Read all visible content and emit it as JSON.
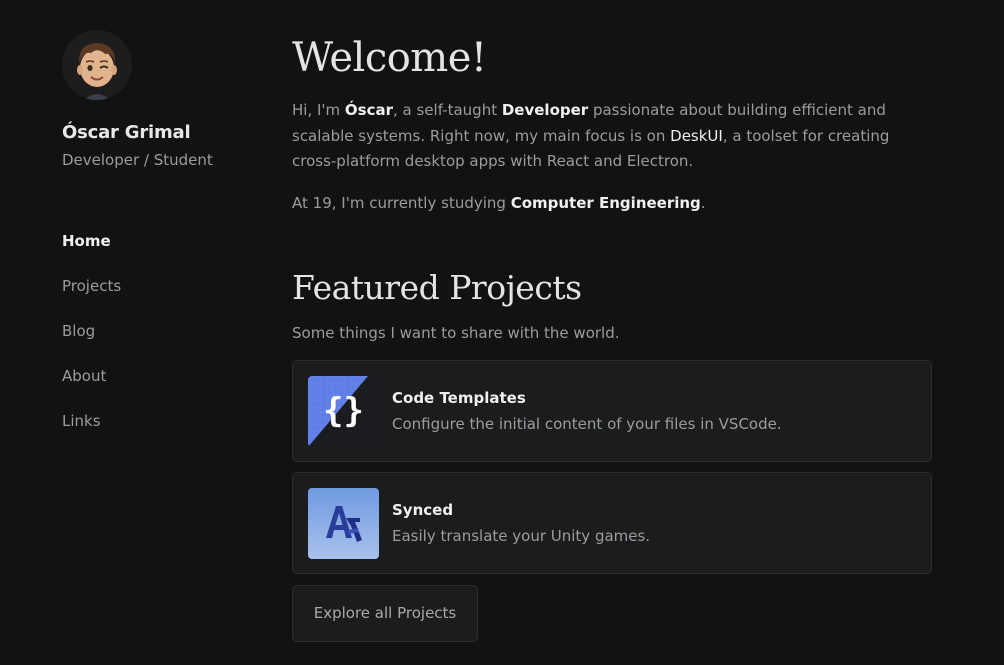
{
  "profile": {
    "name": "Óscar Grimal",
    "role": "Developer / Student"
  },
  "nav": [
    {
      "label": "Home",
      "active": true
    },
    {
      "label": "Projects",
      "active": false
    },
    {
      "label": "Blog",
      "active": false
    },
    {
      "label": "About",
      "active": false
    },
    {
      "label": "Links",
      "active": false
    }
  ],
  "intro": {
    "title": "Welcome!",
    "p1": {
      "t1": "Hi, I'm ",
      "b1": "Óscar",
      "t2": ", a self-taught ",
      "b2": "Developer",
      "t3": " passionate about building efficient and scalable systems. Right now, my main focus is on ",
      "b3": "DeskUI",
      "t4": ", a toolset for creating cross-platform desktop apps with React and Electron."
    },
    "p2": {
      "t1": "At 19, I'm currently studying ",
      "b1": "Computer Engineering",
      "t2": "."
    }
  },
  "featured": {
    "title": "Featured Projects",
    "subtitle": "Some things I want to share with the world.",
    "projects": [
      {
        "title": "Code Templates",
        "description": "Configure the initial content of your files in VSCode.",
        "icon": "braces-icon"
      },
      {
        "title": "Synced",
        "description": "Easily translate your Unity games.",
        "icon": "translate-icon"
      }
    ],
    "explore_label": "Explore all Projects"
  },
  "colors": {
    "background": "#111213",
    "card": "#1a1c1d",
    "text_strong": "#f0f0f0",
    "text_muted": "#9b9c9e"
  }
}
